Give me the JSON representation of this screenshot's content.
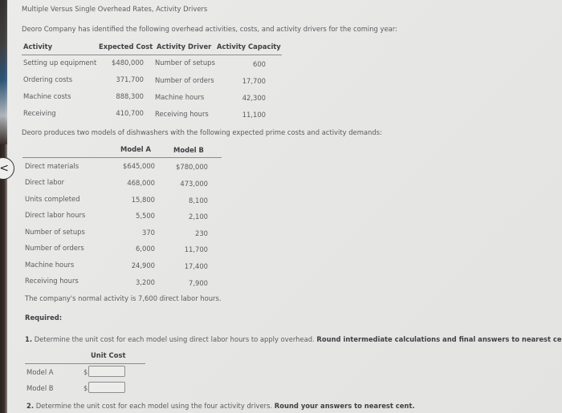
{
  "title": "Multiple Versus Single Overhead Rates, Activity Drivers",
  "intro": "Deoro Company has identified the following overhead activities, costs, and activity drivers for the coming year:",
  "activity_table": {
    "headers": [
      "Activity",
      "Expected Cost",
      "Activity Driver",
      "Activity Capacity"
    ],
    "rows": [
      {
        "activity": "Setting up equipment",
        "cost": "$480,000",
        "driver": "Number of setups",
        "capacity": "600"
      },
      {
        "activity": "Ordering costs",
        "cost": "371,700",
        "driver": "Number of orders",
        "capacity": "17,700"
      },
      {
        "activity": "Machine costs",
        "cost": "888,300",
        "driver": "Machine hours",
        "capacity": "42,300"
      },
      {
        "activity": "Receiving",
        "cost": "410,700",
        "driver": "Receiving hours",
        "capacity": "11,100"
      }
    ]
  },
  "models_intro": "Deoro produces two models of dishwashers with the following expected prime costs and activity demands:",
  "models_table": {
    "headers": [
      "",
      "Model A",
      "Model B"
    ],
    "rows": [
      {
        "label": "Direct materials",
        "a": "$645,000",
        "b": "$780,000"
      },
      {
        "label": "Direct labor",
        "a": "468,000",
        "b": "473,000"
      },
      {
        "label": "Units completed",
        "a": "15,800",
        "b": "8,100"
      },
      {
        "label": "Direct labor hours",
        "a": "5,500",
        "b": "2,100"
      },
      {
        "label": "Number of setups",
        "a": "370",
        "b": "230"
      },
      {
        "label": "Number of orders",
        "a": "6,000",
        "b": "11,700"
      },
      {
        "label": "Machine hours",
        "a": "24,900",
        "b": "17,400"
      },
      {
        "label": "Receiving hours",
        "a": "3,200",
        "b": "7,900"
      }
    ]
  },
  "normal_activity": "The company's normal activity is 7,600 direct labor hours.",
  "required_label": "Required:",
  "q1": {
    "number": "1.",
    "text": "Determine the unit cost for each model using direct labor hours to apply overhead.",
    "bold": "Round intermediate calculations and final answers to nearest cent."
  },
  "answer_table": {
    "header": "Unit Cost",
    "rows": [
      {
        "label": "Model A",
        "currency": "$",
        "value": ""
      },
      {
        "label": "Model B",
        "currency": "$",
        "value": ""
      }
    ]
  },
  "q2": {
    "number": "2.",
    "text": "Determine the unit cost for each model using the four activity drivers.",
    "bold": "Round your answers to nearest cent."
  },
  "nav": {
    "back_icon": "chevron-left-icon"
  }
}
